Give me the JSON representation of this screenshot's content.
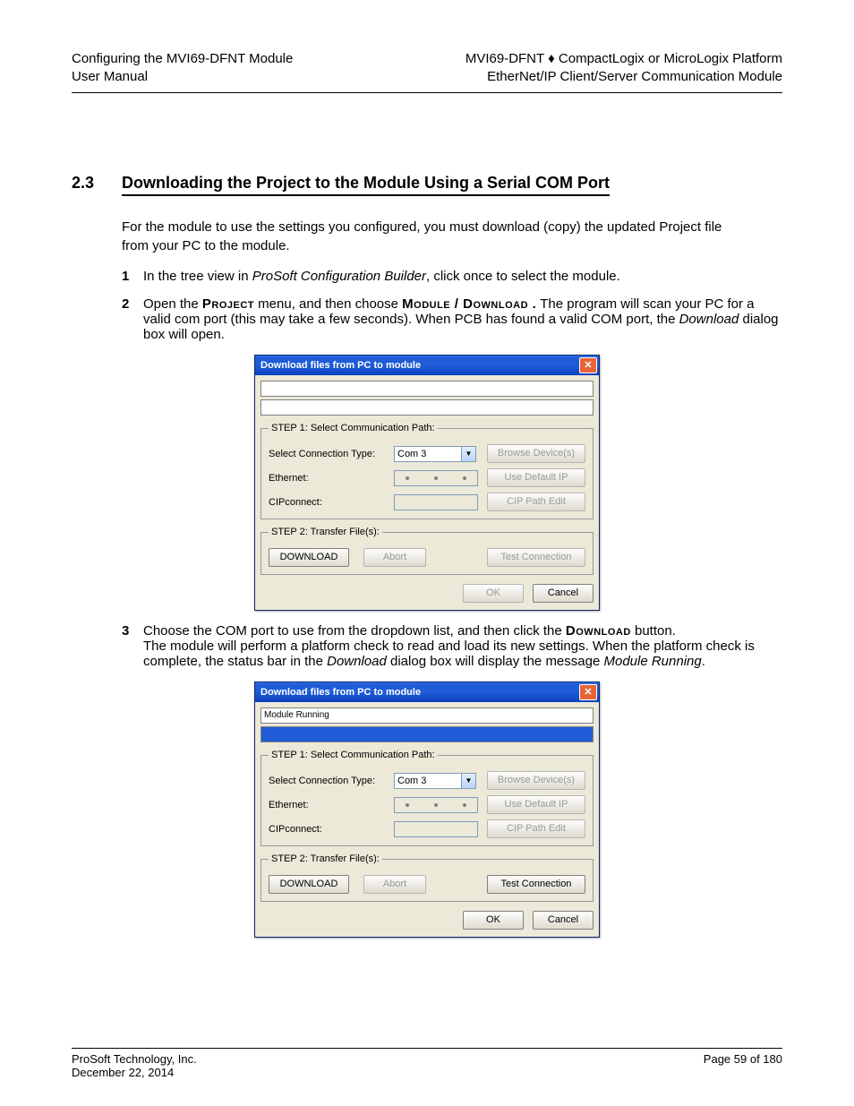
{
  "header": {
    "left_line1": "Configuring the MVI69-DFNT Module",
    "left_line2": "User Manual",
    "right_line1_a": "MVI69-DFNT ",
    "right_line1_b": " CompactLogix or MicroLogix Platform",
    "right_line2": "EtherNet/IP Client/Server Communication Module",
    "diamond": "♦"
  },
  "section": {
    "number": "2.3",
    "title": "Downloading the Project to the Module Using a Serial COM Port"
  },
  "paragraph": "For the module to use the settings you configured, you must download (copy) the updated Project file from your PC to the module.",
  "steps": [
    {
      "num": "1",
      "pre": "In the tree view in ",
      "italic": "ProSoft Configuration Builder",
      "post1": ", click once to select the module.",
      "post2": ""
    },
    {
      "num": "2",
      "pre": "Open the ",
      "bold": "Project",
      "mid": " menu, and then choose ",
      "bold2": "Module / Download .",
      "post": " The program will scan your PC for a valid com port (this may take a few seconds). When PCB has found a valid COM port, the ",
      "italic": "Download",
      "post2": " dialog box will open."
    },
    {
      "num": "3",
      "pre": "Choose the COM port to use from the dropdown list, and then click the ",
      "bold": "Download",
      "post": " button.",
      "post_line2": "The module will perform a platform check to read and load its new settings. When the platform check is complete, the status bar in the ",
      "italic": "Download",
      "post3": " dialog box will display the message ",
      "italic2": "Module Running",
      "post4": "."
    }
  ],
  "dialog": {
    "title": "Download files from PC to module",
    "status1_blank": "",
    "status1_running": "Module Running",
    "step1_legend": "STEP 1: Select Communication Path:",
    "label_conn_type": "Select Connection Type:",
    "conn_value": "Com 3",
    "btn_browse": "Browse Device(s)",
    "label_ethernet": "Ethernet:",
    "btn_defaultip": "Use Default IP",
    "label_cip": "CIPconnect:",
    "btn_cip": "CIP Path Edit",
    "step2_legend": "STEP 2: Transfer File(s):",
    "btn_download": "DOWNLOAD",
    "btn_abort": "Abort",
    "btn_test": "Test Connection",
    "btn_ok": "OK",
    "btn_cancel": "Cancel"
  },
  "footer": {
    "company": "ProSoft Technology, Inc.",
    "page": "Page 59 of 180",
    "date": "December 22, 2014"
  }
}
